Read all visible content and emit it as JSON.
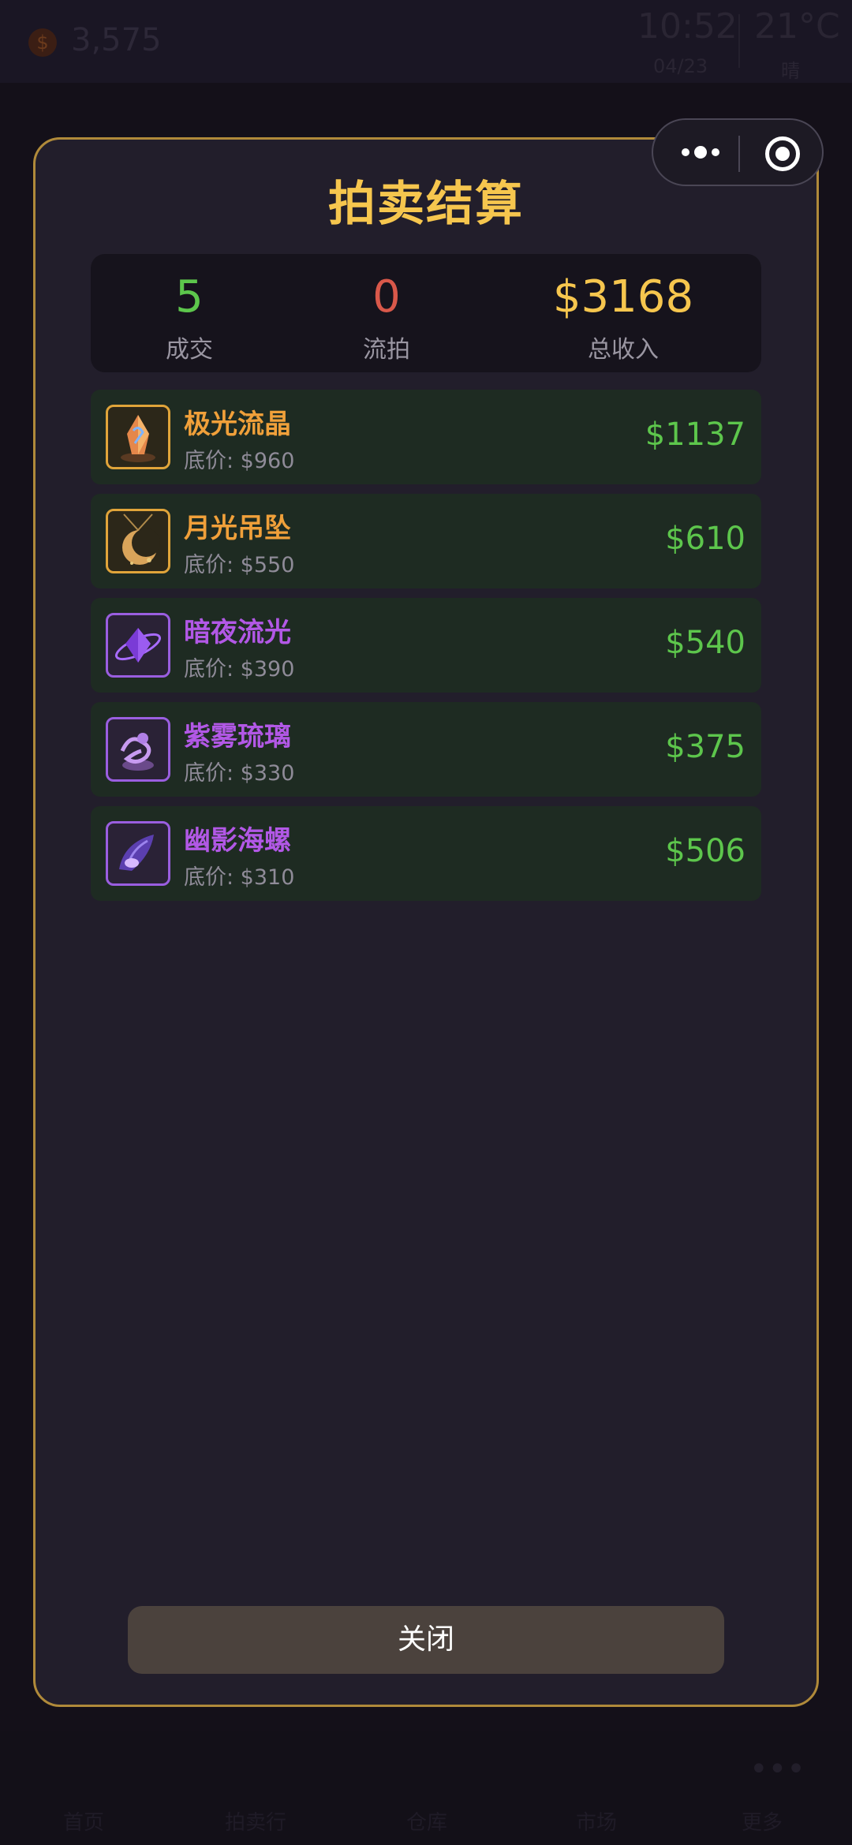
{
  "background": {
    "money": "3,575",
    "time": "10:52",
    "date": "04/23",
    "temperature": "21°C",
    "weather": "晴",
    "nav_items": [
      "首页",
      "拍卖行",
      "仓库",
      "市场",
      "更多"
    ]
  },
  "modal": {
    "title": "拍卖结算",
    "summary": {
      "deals_value": "5",
      "deals_label": "成交",
      "passed_value": "0",
      "passed_label": "流拍",
      "income_value": "$3168",
      "income_label": "总收入"
    },
    "items": [
      {
        "name": "极光流晶",
        "base": "底价: $960",
        "price": "$1137",
        "rarity": "gold",
        "icon": "crystal-icon"
      },
      {
        "name": "月光吊坠",
        "base": "底价: $550",
        "price": "$610",
        "rarity": "gold",
        "icon": "moon-pendant-icon"
      },
      {
        "name": "暗夜流光",
        "base": "底价: $390",
        "price": "$540",
        "rarity": "purple",
        "icon": "dark-gem-icon"
      },
      {
        "name": "紫雾琉璃",
        "base": "底价: $330",
        "price": "$375",
        "rarity": "purple",
        "icon": "mist-glass-icon"
      },
      {
        "name": "幽影海螺",
        "base": "底价: $310",
        "price": "$506",
        "rarity": "purple",
        "icon": "conch-icon"
      }
    ],
    "close_label": "关闭"
  },
  "colors": {
    "accent_gold": "#f6c64e",
    "success_green": "#5dc64c",
    "fail_red": "#d9584a",
    "rarity_gold": "#f0a03a",
    "rarity_purple": "#b258e6"
  }
}
